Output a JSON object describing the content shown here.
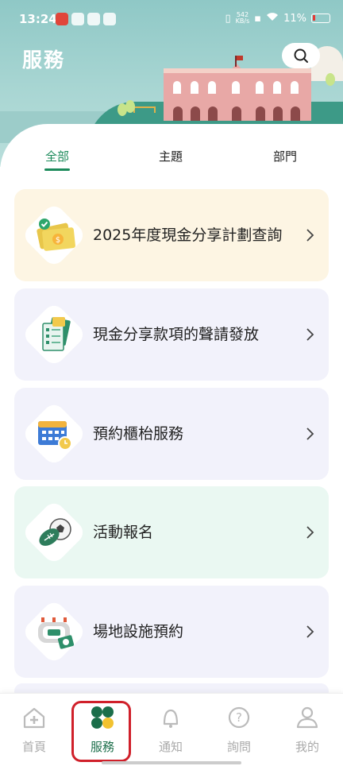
{
  "status_bar": {
    "time": "13:24",
    "net_speed_top": "542",
    "net_speed_unit": "KB/s",
    "battery": "11%"
  },
  "header": {
    "title": "服務",
    "search_icon": "search-icon"
  },
  "tabs": [
    {
      "label": "全部",
      "active": true
    },
    {
      "label": "主題",
      "active": false
    },
    {
      "label": "部門",
      "active": false
    }
  ],
  "cards": [
    {
      "label": "2025年度現金分享計劃查詢",
      "icon": "cash-check-icon",
      "bg": "#fdf5e3"
    },
    {
      "label": "現金分享款項的聲請發放",
      "icon": "cash-checklist-icon",
      "bg": "#f2f2fb"
    },
    {
      "label": "預約櫃枱服務",
      "icon": "calendar-clock-icon",
      "bg": "#f2f2fb"
    },
    {
      "label": "活動報名",
      "icon": "sports-ball-icon",
      "bg": "#eaf8f2"
    },
    {
      "label": "場地設施預約",
      "icon": "venue-booking-icon",
      "bg": "#f2f2fb"
    }
  ],
  "bottom_nav": [
    {
      "label": "首頁",
      "icon": "home-icon"
    },
    {
      "label": "服務",
      "icon": "services-icon",
      "active": true
    },
    {
      "label": "通知",
      "icon": "bell-icon"
    },
    {
      "label": "詢問",
      "icon": "question-icon"
    },
    {
      "label": "我的",
      "icon": "profile-icon"
    }
  ],
  "colors": {
    "accent": "#1b8a5a",
    "highlight_border": "#d0202a",
    "header_bg": "#a9d6d3"
  }
}
